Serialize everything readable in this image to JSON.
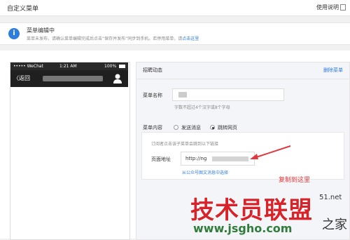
{
  "header": {
    "title": "自定义菜单",
    "help": "使用说明"
  },
  "notice": {
    "title": "菜单编辑中",
    "text": "菜单未发布，请确认菜单编辑完成后点击“保存并发布”同步到手机。若停用菜单，请",
    "link": "点击这里",
    "icon": "info-icon"
  },
  "phone": {
    "status": {
      "carrier": "••••• WeChat",
      "time": "1:21 AM",
      "battery": "100%"
    },
    "nav": {
      "back": "返回"
    }
  },
  "editor": {
    "menu_name": "招聘动态",
    "delete": "删除菜单",
    "name_label": "菜单名称",
    "name_hint": "字数不超过4个汉字或8个字母",
    "content_label": "菜单内容",
    "option_send": "发送消息",
    "option_jump": "跳转网页",
    "jump_hint": "订阅者点击该子菜单会跳到以下链接",
    "url_label": "页面地址",
    "url_value": "http://ng",
    "select_link": "从公众号图文消息中选择"
  },
  "annotation": "复制到这里",
  "watermark": {
    "main": "技术员联盟",
    "url": "www.jsgho.com",
    "side_a": "51.net",
    "side_b": "之家"
  },
  "colors": {
    "accent": "#2e7cdc",
    "annotation": "#e0393e",
    "watermark_red": "#d8232a",
    "watermark_green": "#2f7c3b"
  }
}
